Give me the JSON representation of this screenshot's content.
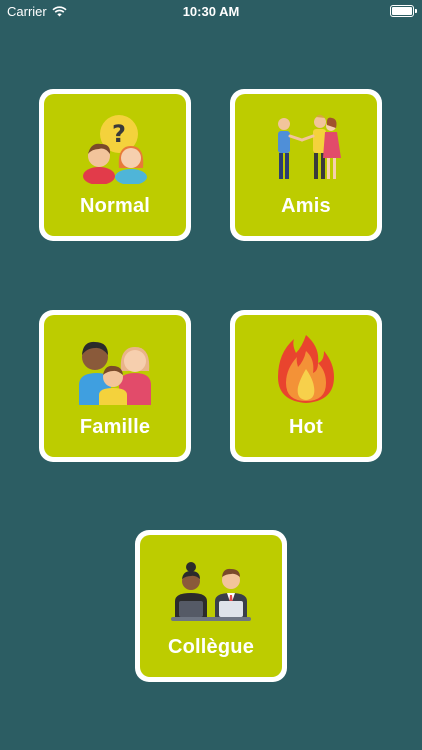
{
  "status_bar": {
    "carrier": "Carrier",
    "time": "10:30 AM"
  },
  "categories": [
    {
      "label": "Normal",
      "icon": "question-people-icon"
    },
    {
      "label": "Amis",
      "icon": "friends-icon"
    },
    {
      "label": "Famille",
      "icon": "family-icon"
    },
    {
      "label": "Hot",
      "icon": "fire-icon"
    },
    {
      "label": "Collègue",
      "icon": "colleagues-icon"
    }
  ],
  "colors": {
    "background": "#2c5d63",
    "card_border": "#ffffff",
    "card_fill": "#bdcc00",
    "label": "#ffffff"
  }
}
